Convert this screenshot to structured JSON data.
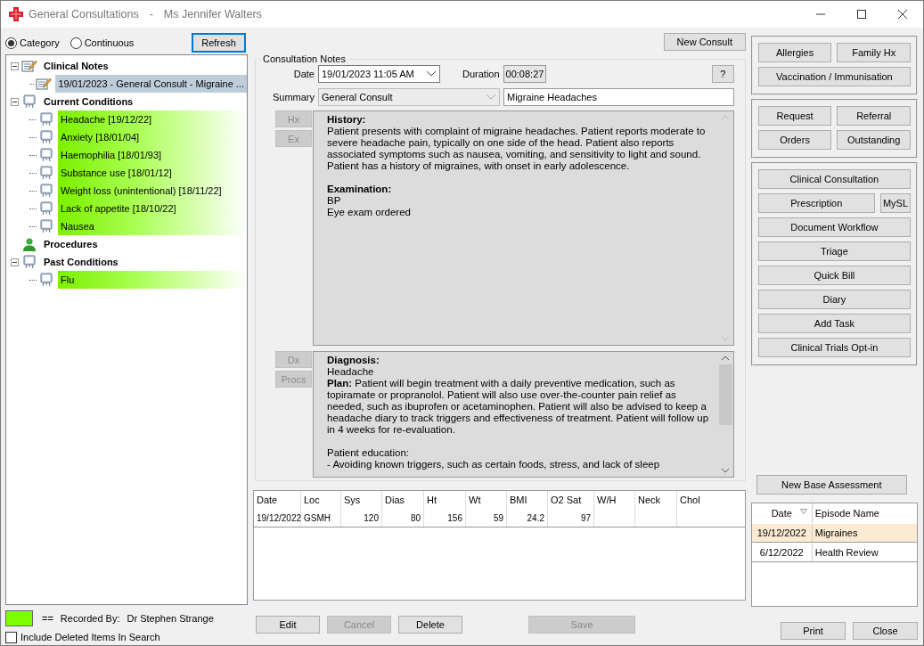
{
  "window": {
    "title": "General Consultations",
    "separator": "-",
    "patient": "Ms Jennifer Walters"
  },
  "view_mode": [
    {
      "label": "Category",
      "selected": true
    },
    {
      "label": "Continuous",
      "selected": false
    }
  ],
  "refresh_button": "Refresh",
  "tree": [
    {
      "label": "Clinical Notes",
      "kind": "note",
      "expanded": true,
      "children": [
        {
          "label": "19/01/2023 - General Consult - Migraine ...",
          "kind": "note",
          "selected": true,
          "highlighted": false
        }
      ]
    },
    {
      "label": "Current Conditions",
      "kind": "condition",
      "expanded": true,
      "children": [
        {
          "label": "Headache [19/12/22]",
          "kind": "condition",
          "selected": false,
          "highlighted": true
        },
        {
          "label": "Anxiety [18/01/04]",
          "kind": "condition",
          "selected": false,
          "highlighted": true
        },
        {
          "label": "Haemophilia [18/01/93]",
          "kind": "condition",
          "selected": false,
          "highlighted": true
        },
        {
          "label": "Substance use [18/01/12]",
          "kind": "condition",
          "selected": false,
          "highlighted": true
        },
        {
          "label": "Weight loss (unintentional) [18/11/22]",
          "kind": "condition",
          "selected": false,
          "highlighted": true
        },
        {
          "label": "Lack of appetite [18/10/22]",
          "kind": "condition",
          "selected": false,
          "highlighted": true
        },
        {
          "label": "Nausea",
          "kind": "condition",
          "selected": false,
          "highlighted": true
        }
      ]
    },
    {
      "label": "Procedures",
      "kind": "procedure"
    },
    {
      "label": "Past Conditions",
      "kind": "condition",
      "expanded": true,
      "children": [
        {
          "label": "Flu",
          "kind": "condition",
          "selected": false,
          "highlighted": true
        }
      ]
    }
  ],
  "legend": {
    "color": "#80ff00",
    "separator": "==",
    "label": "Recorded By:",
    "value": "Dr Stephen Strange"
  },
  "include_deleted": {
    "label": "Include Deleted Items In Search",
    "checked": false
  },
  "new_consult_button": "New Consult",
  "consultation_notes": {
    "title": "Consultation Notes",
    "date_label": "Date",
    "date": "19/01/2023  11:05 AM",
    "duration_label": "Duration",
    "duration": "00:08:27",
    "help_button": "?",
    "summary_label": "Summary",
    "summary_type": "General Consult",
    "summary_text": "Migraine Headaches",
    "side_buttons_top": [
      {
        "label": "Hx",
        "disabled": true
      },
      {
        "label": "Ex",
        "disabled": true
      }
    ],
    "side_buttons_bottom": [
      {
        "label": "Dx",
        "disabled": true
      },
      {
        "label": "Procs",
        "disabled": true
      }
    ],
    "history_blocks": [
      {
        "kind": "heading",
        "text": "History:",
        "gap_before": false
      },
      {
        "kind": "text",
        "text": "Patient presents with complaint of migraine headaches. Patient reports moderate to severe headache pain, typically on one side of the head. Patient also reports associated symptoms such as nausea, vomiting, and sensitivity to light and sound. Patient has a history of migraines, with onset in early adolescence.",
        "gap_before": false
      },
      {
        "kind": "heading",
        "text": "Examination:",
        "gap_before": true
      },
      {
        "kind": "text",
        "text": "BP",
        "gap_before": false
      },
      {
        "kind": "text",
        "text": "Eye exam ordered",
        "gap_before": false
      }
    ],
    "diagnosis_blocks": [
      {
        "kind": "heading",
        "text": "Diagnosis:",
        "gap_before": false
      },
      {
        "kind": "text",
        "text": "Headache",
        "gap_before": false
      },
      {
        "kind": "text",
        "text": "**Plan:**  Patient will begin treatment with a daily preventive medication, such as topiramate or propranolol. Patient will also use over-the-counter pain relief as needed, such as ibuprofen or acetaminophen. Patient will also be advised to keep a headache diary to track triggers and effectiveness of treatment. Patient will follow up in 4 weeks for re-evaluation.",
        "gap_before": false
      },
      {
        "kind": "text",
        "text": "Patient education:",
        "gap_before": true
      },
      {
        "kind": "text",
        "text": "- Avoiding known triggers, such as certain foods, stress, and lack of sleep",
        "gap_before": false
      }
    ]
  },
  "vitals": {
    "columns": [
      "Date",
      "Loc",
      "Sys",
      "Dias",
      "Ht",
      "Wt",
      "BMI",
      "O2 Sat",
      "W/H",
      "Neck",
      "Chol"
    ],
    "rows": [
      [
        "19/12/2022",
        "GSMH",
        "120",
        "80",
        "156",
        "59",
        "24.2",
        "97",
        "",
        "",
        ""
      ]
    ]
  },
  "bottom_buttons": [
    {
      "label": "Edit",
      "disabled": false
    },
    {
      "label": "Cancel",
      "disabled": true
    },
    {
      "label": "Delete",
      "disabled": false
    },
    {
      "label": "Save",
      "disabled": true
    }
  ],
  "button_groups": [
    {
      "rows": [
        [
          "Allergies",
          "Family Hx"
        ],
        [
          "Vaccination / Immunisation"
        ]
      ]
    },
    {
      "rows": [
        [
          "Request",
          "Referral"
        ],
        [
          "Orders",
          "Outstanding"
        ]
      ]
    },
    {
      "rows": [
        [
          "Clinical Consultation"
        ],
        [
          "Prescription",
          "MySL"
        ],
        [
          "Document Workflow"
        ],
        [
          "Triage"
        ],
        [
          "Quick Bill"
        ],
        [
          "Diary"
        ],
        [
          "Add Task"
        ],
        [
          "Clinical Trials Opt-in"
        ]
      ]
    }
  ],
  "new_base_assessment_button": "New Base Assessment",
  "episodes": {
    "columns": [
      "Date",
      "Episode Name"
    ],
    "rows": [
      {
        "date": "19/12/2022",
        "name": "Migraines",
        "selected": true
      },
      {
        "date": "6/12/2022",
        "name": "Health Review",
        "selected": false
      }
    ]
  },
  "window_buttons": [
    "Print",
    "Close"
  ]
}
